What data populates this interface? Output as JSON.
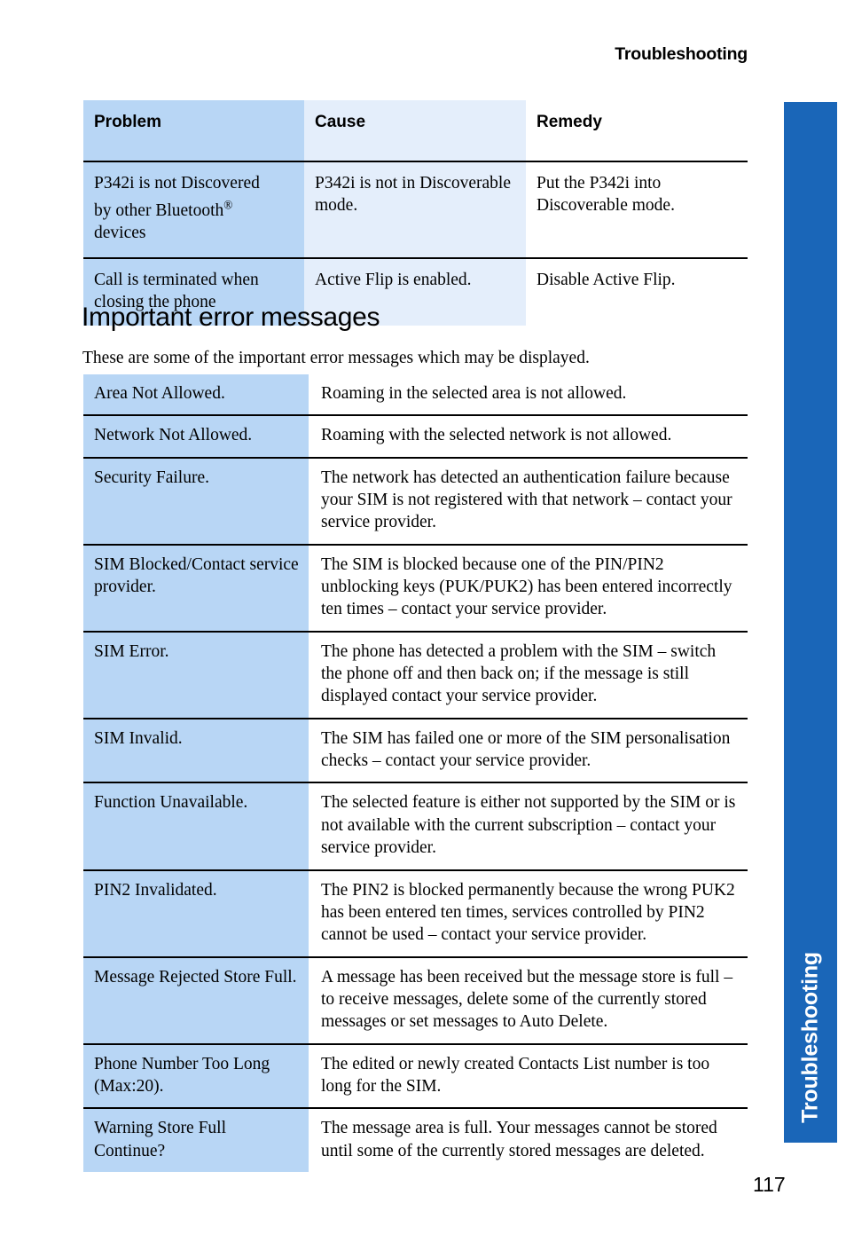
{
  "page": {
    "running_head": "Troubleshooting",
    "page_number": "117",
    "thumb_tab_label": "Troubleshooting",
    "accent_color": "#1a66b8",
    "tint_primary": "#b8d6f5",
    "tint_secondary": "#e4eefb"
  },
  "problem_table": {
    "headers": [
      "Problem",
      "Cause",
      "Remedy"
    ],
    "rows": [
      {
        "problem_line1": "P342i is not Discovered",
        "problem_line2": "by other Bluetooth",
        "problem_reg": "®",
        "problem_line3": "devices",
        "cause": "P342i is not in Discoverable mode.",
        "remedy": "Put the P342i into Discoverable mode."
      },
      {
        "problem_line1": "Call is terminated when",
        "problem_line2": "closing the phone",
        "problem_reg": "",
        "problem_line3": "",
        "cause": "Active Flip is enabled.",
        "remedy": "Disable Active Flip."
      }
    ]
  },
  "section": {
    "heading": "Important error messages",
    "intro": "These are some of the important error messages which may be displayed."
  },
  "error_table": {
    "rows": [
      {
        "message": "Area Not Allowed.",
        "description": "Roaming in the selected area is not allowed."
      },
      {
        "message": "Network Not Allowed.",
        "description": "Roaming with the selected network is not allowed."
      },
      {
        "message": "Security Failure.",
        "description": "The network has detected an authentication failure because your SIM is not registered with that network – contact your service provider."
      },
      {
        "message": "SIM Blocked/Contact service provider.",
        "description": "The SIM is blocked because one of the PIN/PIN2 unblocking keys (PUK/PUK2) has been entered incorrectly ten times – contact your service provider."
      },
      {
        "message": "SIM Error.",
        "description": "The phone has detected a problem with the SIM – switch the phone off and then back on; if the message is still displayed contact your service provider."
      },
      {
        "message": "SIM Invalid.",
        "description": "The SIM has failed one or more of the SIM personalisation checks – contact your service provider."
      },
      {
        "message": "Function Unavailable.",
        "description": "The selected feature is either not supported by the SIM or is not available with the current subscription – contact your service provider."
      },
      {
        "message": "PIN2 Invalidated.",
        "description": "The PIN2 is blocked permanently because the wrong PUK2 has been entered ten times, services controlled by PIN2 cannot be used – contact your service provider."
      },
      {
        "message": "Message Rejected Store Full.",
        "description": "A message has been received but the message store is full – to receive messages, delete some of the currently stored messages or set messages to Auto Delete."
      },
      {
        "message": "Phone Number Too Long (Max:20).",
        "description": "The edited or newly created Contacts List number is too long for the SIM."
      },
      {
        "message": "Warning Store Full Continue?",
        "description": "The message area is full. Your messages cannot be stored until some of the currently stored messages are deleted."
      }
    ]
  }
}
